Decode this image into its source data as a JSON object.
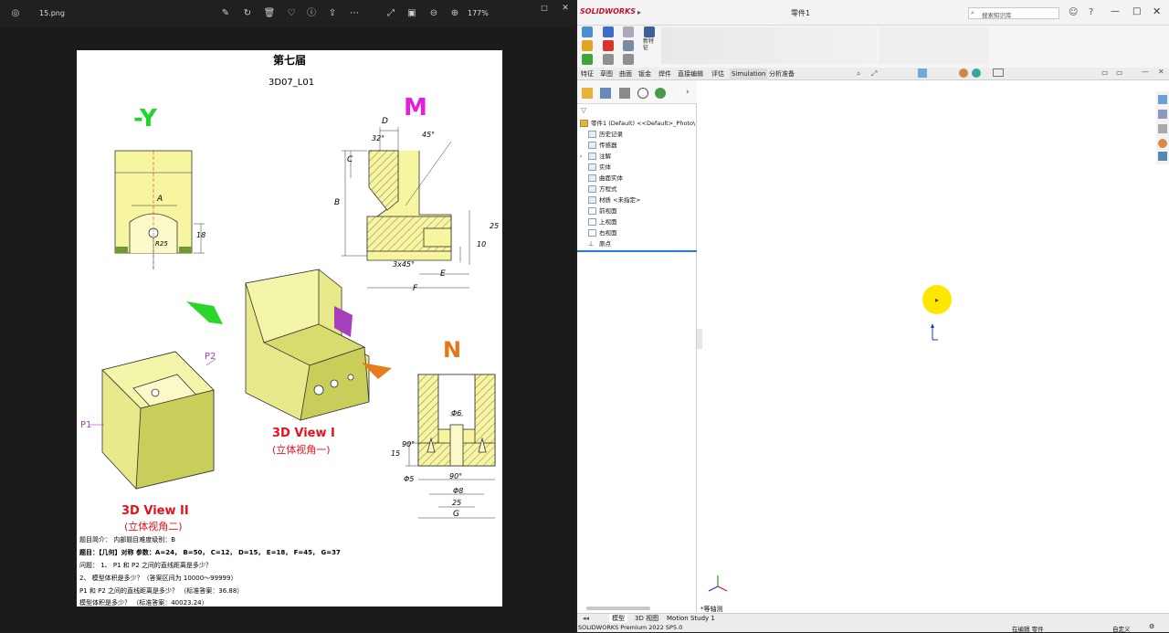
{
  "viewer": {
    "filename": "15.png",
    "zoom": "177%",
    "document": {
      "title": "第七届",
      "code": "3D07_L01",
      "view_labels": {
        "neg_y": "-Y",
        "m": "M",
        "n": "N",
        "view1": "3D View I",
        "view1_cn": "(立体视角一)",
        "view2": "3D View II",
        "view2_cn": "(立体视角二)",
        "p1": "P1",
        "p2": "P2"
      },
      "dims": {
        "D": "D",
        "C": "C",
        "B": "B",
        "E": "E",
        "F": "F",
        "G": "G",
        "A": "A",
        "d32": "32°",
        "d45": "45°",
        "d25": "25",
        "d10": "10",
        "d18": "18",
        "r3x45": "3x45°",
        "phi6": "Φ6",
        "phi5": "Φ5",
        "phi8": "Φ8",
        "d90a": "90°",
        "d90b": "90°",
        "d15": "15",
        "d25b": "25",
        "r825": "R25"
      },
      "text_lines": [
        "题目简介：  内部题目难度级别：B",
        "题目：【几何】对称     参数：A=24，   B=50，   C=12，   D=15，   E=18，   F=45，   G=37",
        "问题：  1、 P1 和 P2 之间的直线距离是多少？",
        "2、  模型体积是多少？（答案区间为 10000～99999）",
        "P1 和 P2 之间的直线距离是多少？    （标准答案：36.88）",
        "模型体积是多少？  （标准答案：40023.24）"
      ]
    }
  },
  "solidworks": {
    "app_name": "SOLIDWORKS",
    "doc_title": "零件1",
    "search_placeholder": "搜索知识库",
    "ribbon_new": "新特征",
    "tabs": [
      "特征",
      "草图",
      "曲面",
      "钣金",
      "焊件",
      "直接编辑",
      "评估",
      "Simulation",
      "分析准备"
    ],
    "tree": {
      "root": "零件1 (Default) <<Default>_Photo\\",
      "items": [
        "历史记录",
        "传感器",
        "注解",
        "实体",
        "曲面实体",
        "方程式",
        "材质 <未指定>",
        "前视面",
        "上视面",
        "右视面",
        "原点"
      ]
    },
    "bottom_tabs": [
      "模型",
      "3D 视图",
      "Motion Study 1"
    ],
    "view_label": "*等轴测",
    "status": {
      "left": "SOLIDWORKS Premium 2022 SP5.0",
      "editing": "在编辑 零件",
      "custom": "自定义"
    },
    "colors": {
      "accent": "#c8102e",
      "cursor": "#ffe600",
      "tree_line": "#1e7fd2"
    }
  }
}
